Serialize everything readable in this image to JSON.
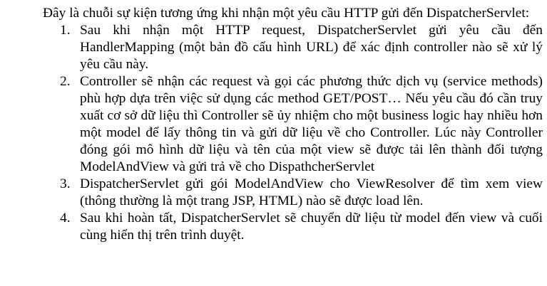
{
  "intro": "Đây là chuỗi sự kiện tương ứng khi nhận một yêu cầu HTTP gửi đến DispatcherServlet:",
  "steps": [
    {
      "num": "1.",
      "text": "Sau khi nhận một HTTP request, DispatcherServlet  gửi yêu cầu đến HandlerMapping (một bản đồ cấu hình URL) để xác định controller nào sẽ xử lý yêu cầu này."
    },
    {
      "num": "2.",
      "text": "Controller sẽ nhận các request và gọi các phương thức dịch vụ (service methods) phù hợp dựa trên việc sử dụng các method GET/POST… Nếu yêu cầu đó cần truy xuất cơ sở dữ liệu thì Controller sẽ ủy nhiệm cho một business logic hay nhiều hơn một model để lấy thông tin và gửi dữ liệu về cho Controller. Lúc này Controller đóng gói mô hình dữ liệu và tên của một view sẽ được tải lên thành đối tượng ModelAndView và gửi trả về cho DispathcherServlet"
    },
    {
      "num": "3.",
      "text": "DispatcherServlet gửi gói ModelAndView cho ViewResolver để tìm xem view (thông thường là một trang JSP, HTML) nào sẽ được load lên."
    },
    {
      "num": "4.",
      "text": "Sau khi hoàn tất, DispatcherServlet sẽ chuyển dữ liệu từ model đến view và cuối cùng hiển thị trên trình duyệt."
    }
  ]
}
